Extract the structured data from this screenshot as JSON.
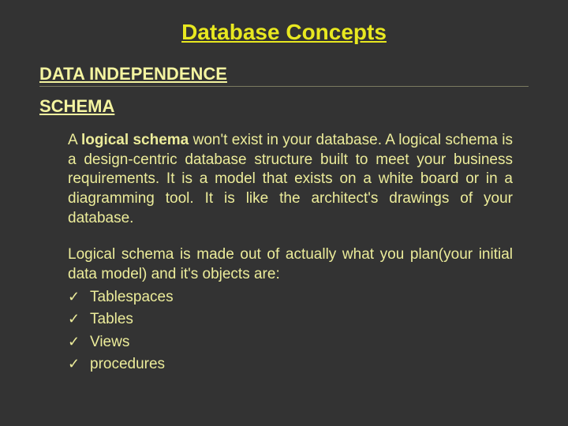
{
  "title": "Database Concepts",
  "heading1": "DATA INDEPENDENCE",
  "heading2": "SCHEMA",
  "para1_prefix": "A ",
  "para1_bold": "logical schema",
  "para1_rest": " won't exist in your database. A logical schema is a design-centric database structure built to meet your business requirements. It is a model that exists on a white board or in a diagramming tool. It is like the architect's drawings of your database.",
  "para2": "Logical schema is made out of actually what you plan(your initial data model) and it's objects are:",
  "check": "✓",
  "items": [
    "Tablespaces",
    "Tables",
    "Views",
    "procedures"
  ]
}
